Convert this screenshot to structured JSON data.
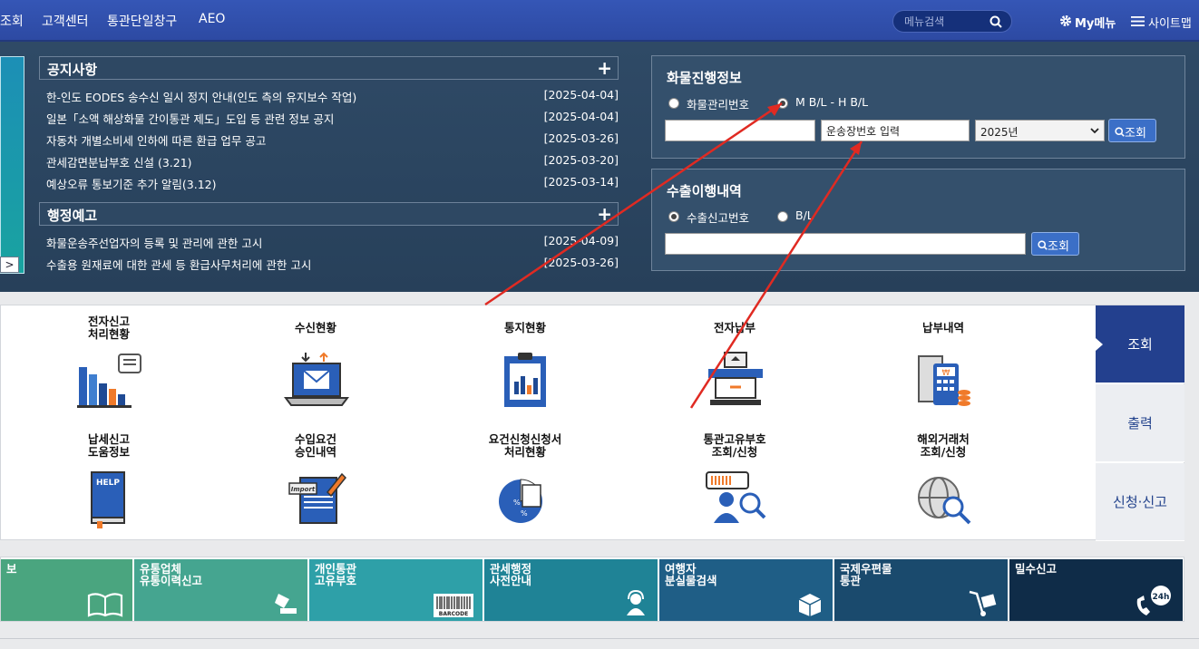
{
  "topnav": {
    "links": [
      "조회",
      "고객센터",
      "통관단일창구",
      "AEO"
    ],
    "search_placeholder": "메뉴검색",
    "mymenu": "My메뉴",
    "sitemap": "사이트맵"
  },
  "notices": {
    "title": "공지사항",
    "plus": "+",
    "items": [
      {
        "text": "한-인도 EODES 송수신 일시 정지 안내(인도 측의 유지보수 작업)",
        "date": "[2025-04-04]"
      },
      {
        "text": "일본「소액 해상화물 간이통관 제도」도입 등 관련 정보 공지",
        "date": "[2025-04-04]"
      },
      {
        "text": "자동차 개별소비세 인하에 따른 환급 업무 공고",
        "date": "[2025-03-26]"
      },
      {
        "text": "관세감면분납부호 신설 (3.21)",
        "date": "[2025-03-20]"
      },
      {
        "text": "예상오류 통보기준 추가 알림(3.12)",
        "date": "[2025-03-14]"
      }
    ]
  },
  "admin": {
    "title": "행정예고",
    "plus": "+",
    "items": [
      {
        "text": "화물운송주선업자의 등록 및 관리에 관한 고시",
        "date": "[2025-04-09]"
      },
      {
        "text": "수출용 원재료에 대한 관세 등 환급사무처리에 관한 고시",
        "date": "[2025-03-26]"
      }
    ]
  },
  "banner": {
    "next": ">"
  },
  "cargo": {
    "title": "화물진행정보",
    "radio1": "화물관리번호",
    "radio2": "M B/L - H B/L",
    "field2_value": "운송장번호 입력",
    "year": "2025년",
    "button": "조회"
  },
  "export": {
    "title": "수출이행내역",
    "radio1": "수출신고번호",
    "radio2": "B/L",
    "button": "조회"
  },
  "services": [
    {
      "label": "전자신고\n처리현황"
    },
    {
      "label": "수신현황"
    },
    {
      "label": "통지현황"
    },
    {
      "label": "전자납부"
    },
    {
      "label": "납부내역"
    },
    {
      "label": "납세신고\n도움정보"
    },
    {
      "label": "수입요건\n승인내역"
    },
    {
      "label": "요건신청신청서\n처리현황"
    },
    {
      "label": "통관고유부호\n조회/신청"
    },
    {
      "label": "해외거래처\n조회/신청"
    }
  ],
  "icon_texts": {
    "help": "HELP",
    "import": "Import",
    "percent": "%",
    "won": "₩",
    "barcode": "BARCODE",
    "h24": "24h"
  },
  "sidetabs": [
    "조회",
    "출력",
    "신청·신고"
  ],
  "tiles": [
    {
      "label": "보",
      "color": "#4aa57f"
    },
    {
      "label": "유통업체\n유통이력신고",
      "color": "#45a590"
    },
    {
      "label": "개인통관\n고유부호",
      "color": "#2ea0a8"
    },
    {
      "label": "관세행정\n사전안내",
      "color": "#1f8396"
    },
    {
      "label": "여행자\n분실물검색",
      "color": "#1f5e86"
    },
    {
      "label": "국제우편물\n통관",
      "color": "#1a4a6d"
    },
    {
      "label": "밀수신고",
      "color": "#0f2c48"
    }
  ]
}
